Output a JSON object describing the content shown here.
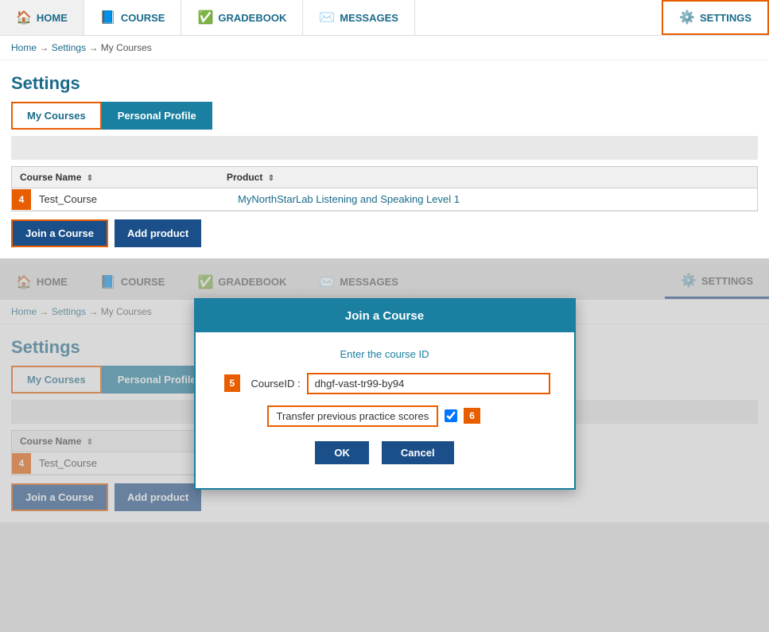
{
  "nav": {
    "home": "HOME",
    "course": "COURSE",
    "gradebook": "GRADEBOOK",
    "messages": "MESSAGES",
    "settings": "SETTINGS"
  },
  "breadcrumb": {
    "home": "Home",
    "settings": "Settings",
    "mycourses": "My Courses"
  },
  "panel1": {
    "title": "Settings",
    "tab_mycourses": "My Courses",
    "tab_personal": "Personal Profile",
    "table": {
      "col_course": "Course Name",
      "col_product": "Product",
      "row_num": "4",
      "course_name": "Test_Course",
      "product_name": "MyNorthStarLab Listening and Speaking Level 1"
    },
    "btn_join": "Join a Course",
    "btn_add": "Add product"
  },
  "panel2": {
    "title": "Settings",
    "tab_mycourses": "My Courses",
    "tab_personal": "Personal Profile",
    "table": {
      "col_course": "Course Name",
      "row_num": "4",
      "course_name": "Test_Course"
    },
    "btn_join": "Join a Course",
    "btn_add": "Add product",
    "dialog": {
      "title": "Join a Course",
      "subtitle": "Enter the course ID",
      "field_label": "CourseID :",
      "field_value": "dhgf-vast-tr99-by94",
      "field_num": "5",
      "transfer_label": "Transfer previous practice scores",
      "transfer_num": "6",
      "btn_ok": "OK",
      "btn_cancel": "Cancel"
    }
  }
}
